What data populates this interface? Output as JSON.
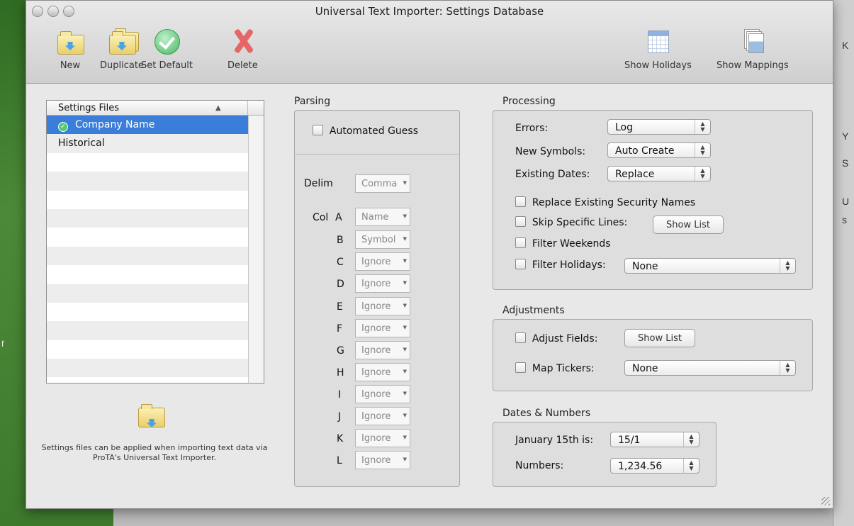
{
  "window": {
    "title": "Universal Text Importer:  Settings Database"
  },
  "toolbar": {
    "new": "New",
    "duplicate": "Duplicate",
    "set_default": "Set Default",
    "delete": "Delete",
    "show_holidays": "Show Holidays",
    "show_mappings": "Show Mappings"
  },
  "settings_files": {
    "header": "Settings Files",
    "items": [
      "Company Name",
      "Historical"
    ],
    "selected": "Company Name",
    "footer": "Settings files can be applied when importing text data via ProTA's Universal Text Importer."
  },
  "parsing": {
    "title": "Parsing",
    "automated_guess": "Automated Guess",
    "delim_label": "Delim",
    "delim_value": "Comma",
    "col_prefix": "Col",
    "columns": [
      {
        "letter": "A",
        "value": "Name"
      },
      {
        "letter": "B",
        "value": "Symbol"
      },
      {
        "letter": "C",
        "value": "Ignore"
      },
      {
        "letter": "D",
        "value": "Ignore"
      },
      {
        "letter": "E",
        "value": "Ignore"
      },
      {
        "letter": "F",
        "value": "Ignore"
      },
      {
        "letter": "G",
        "value": "Ignore"
      },
      {
        "letter": "H",
        "value": "Ignore"
      },
      {
        "letter": "I",
        "value": "Ignore"
      },
      {
        "letter": "J",
        "value": "Ignore"
      },
      {
        "letter": "K",
        "value": "Ignore"
      },
      {
        "letter": "L",
        "value": "Ignore"
      }
    ]
  },
  "processing": {
    "title": "Processing",
    "errors_label": "Errors:",
    "errors_value": "Log",
    "new_symbols_label": "New Symbols:",
    "new_symbols_value": "Auto Create",
    "existing_dates_label": "Existing Dates:",
    "existing_dates_value": "Replace",
    "replace_names": "Replace Existing Security Names",
    "skip_lines": "Skip Specific Lines:",
    "show_list": "Show List",
    "filter_weekends": "Filter Weekends",
    "filter_holidays": "Filter Holidays:",
    "filter_holidays_value": "None"
  },
  "adjustments": {
    "title": "Adjustments",
    "adjust_fields": "Adjust Fields:",
    "show_list": "Show List",
    "map_tickers": "Map Tickers:",
    "map_tickers_value": "None"
  },
  "dates_numbers": {
    "title": "Dates & Numbers",
    "jan15_label": "January 15th is:",
    "jan15_value": "15/1",
    "numbers_label": "Numbers:",
    "numbers_value": "1,234.56"
  },
  "background": {
    "right_edge_letters": [
      "K",
      "Y",
      "S",
      "U",
      "s"
    ],
    "left_letter": "f"
  }
}
